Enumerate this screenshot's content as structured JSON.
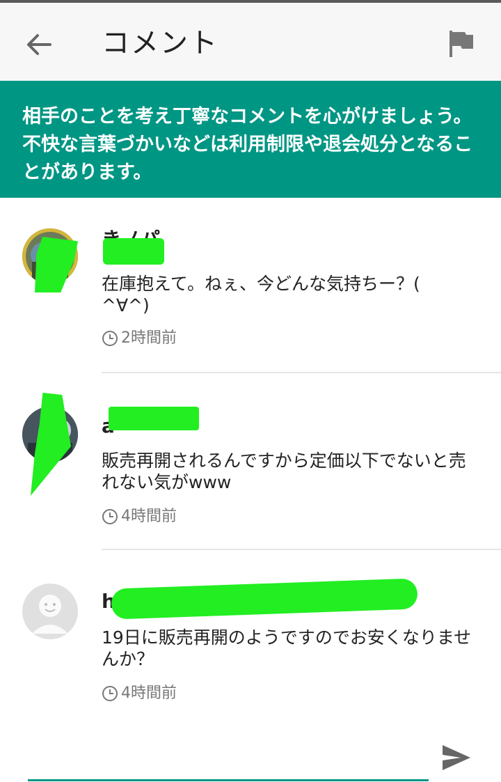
{
  "header": {
    "title": "コメント"
  },
  "notice": {
    "text": "相手のことを考え丁寧なコメントを心がけましょう。不快な言葉づかいなどは利用制限や退会処分となることがあります。"
  },
  "comments": [
    {
      "username": "きノパ",
      "body": "在庫抱えて。ねぇ、今どんな気持ちー？(　^∀^)",
      "time": "2時間前",
      "avatar": "photo-avatar-masked"
    },
    {
      "username": "a",
      "body": "販売再開されるんですから定価以下でないと売れない気がwww",
      "time": "4時間前",
      "avatar": "photo-avatar-masked"
    },
    {
      "username": "h",
      "body": "19日に販売再開のようですのでお安くなりませんか？",
      "time": "4時間前",
      "avatar": "default-avatar"
    }
  ],
  "icons": {
    "back": "arrow-back-icon",
    "flag": "flag-icon",
    "clock": "clock-icon",
    "send": "send-icon",
    "default_avatar": "person-icon"
  },
  "colors": {
    "accent": "#009684",
    "redaction": "#22ee22"
  }
}
